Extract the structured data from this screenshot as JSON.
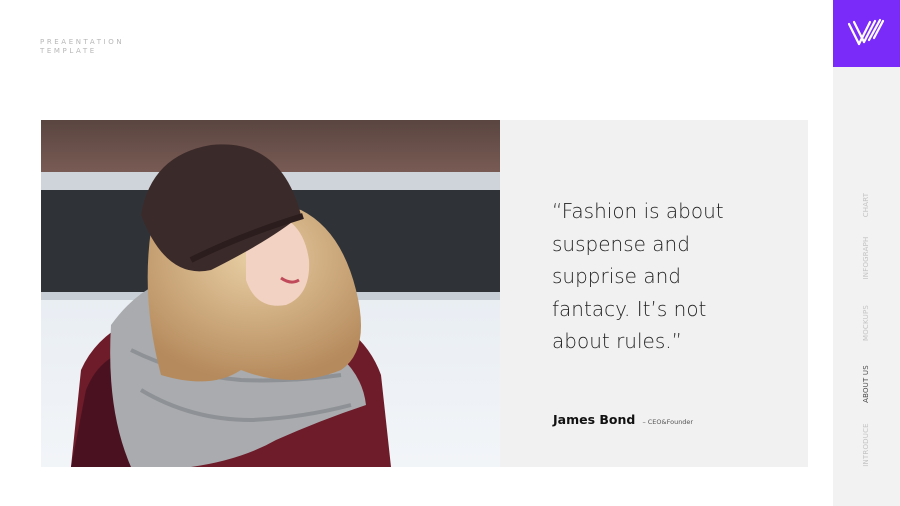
{
  "brand": {
    "line1": "PREAENTATION",
    "line2": "TEMPLATE"
  },
  "quote": {
    "text": "“Fashion is about suspense and supprise and fantacy. It’s not about rules.”",
    "author_name": "James Bond",
    "author_role": "– CEO&Founder"
  },
  "sidebar": {
    "logo_icon": "stripes-logo-icon",
    "accent_color": "#7b2bf9",
    "items": [
      {
        "label": "CHART",
        "active": false
      },
      {
        "label": "INFOGRAPH",
        "active": false
      },
      {
        "label": "MOCKUPS",
        "active": false
      },
      {
        "label": "ABOUT US",
        "active": true
      },
      {
        "label": "INTRODUCE",
        "active": false
      }
    ]
  }
}
